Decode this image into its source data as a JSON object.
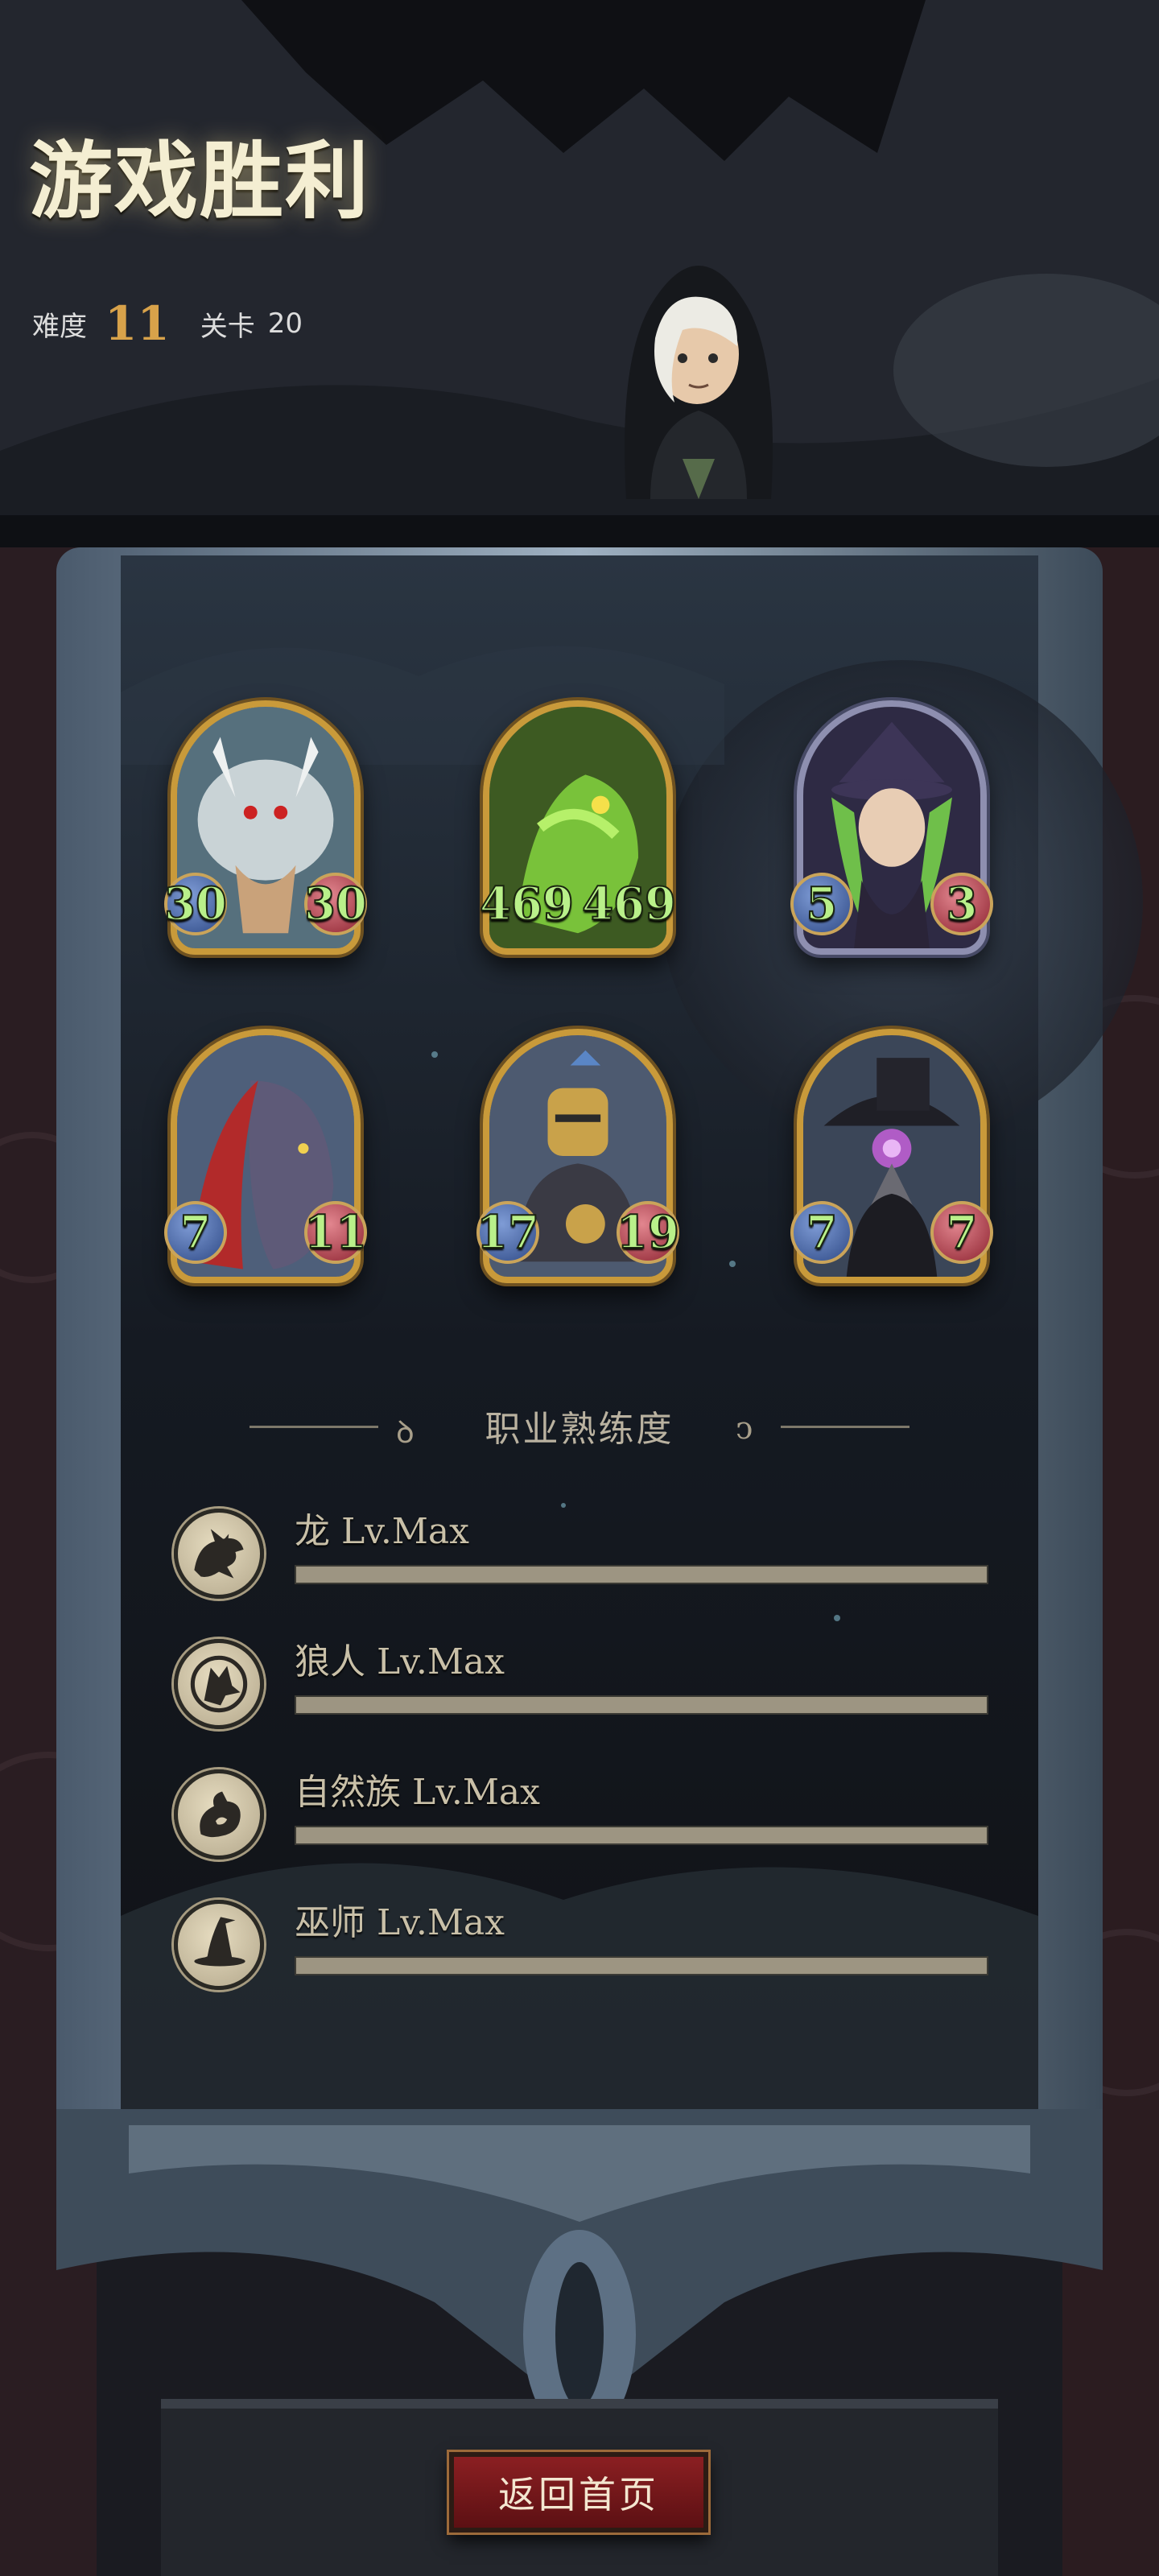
{
  "header": {
    "title": "游戏胜利",
    "difficulty_label": "难度",
    "difficulty_value": "11",
    "stage_label": "关卡",
    "stage_value": "20"
  },
  "team": [
    {
      "name": "white-maned-beast",
      "attack": 30,
      "health": 30,
      "frame": "gold",
      "accent": "#9fb6c4"
    },
    {
      "name": "green-dragon",
      "attack": 469,
      "health": 469,
      "frame": "gold",
      "accent": "#79c23a"
    },
    {
      "name": "green-haired-witch",
      "attack": 5,
      "health": 3,
      "frame": "silver",
      "accent": "#6fbf4a"
    },
    {
      "name": "werewolf",
      "attack": 7,
      "health": 11,
      "frame": "gold",
      "accent": "#b22a2a"
    },
    {
      "name": "armored-knight",
      "attack": 17,
      "health": 19,
      "frame": "gold",
      "accent": "#c9a24a"
    },
    {
      "name": "plague-doctor",
      "attack": 7,
      "health": 7,
      "frame": "gold",
      "accent": "#b05cc6"
    }
  ],
  "mastery": {
    "title": "职业熟练度",
    "items": [
      {
        "label": "龙 Lv.Max",
        "icon": "dragon-icon",
        "progress": 1.0
      },
      {
        "label": "狼人 Lv.Max",
        "icon": "wolf-icon",
        "progress": 1.0
      },
      {
        "label": "自然族 Lv.Max",
        "icon": "nature-icon",
        "progress": 1.0
      },
      {
        "label": "巫师 Lv.Max",
        "icon": "wizard-hat-icon",
        "progress": 1.0
      }
    ]
  },
  "home_button": "返回首页",
  "colors": {
    "gold": "#c99a3a",
    "button": "#7a191c",
    "stat_green": "#b9f08a"
  }
}
